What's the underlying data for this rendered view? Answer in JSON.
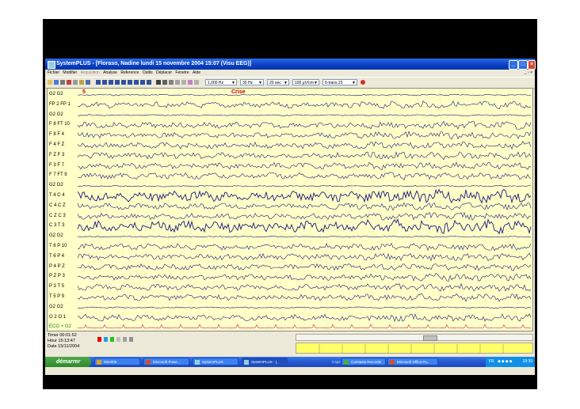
{
  "window": {
    "title": "SystemPLUS - [Floraso, Nadine lundi 15 novembre 2004 15:07 (Visu EEG)]",
    "controls": {
      "minimize": "_",
      "maximize": "□",
      "close": "×"
    }
  },
  "menu": {
    "items": [
      "Fichier",
      "Modifier",
      "Acquisition",
      "Analyse",
      "Reference",
      "Outils",
      "Déplacer",
      "Fenetre",
      "Aide"
    ],
    "right": "_ ▫ ×"
  },
  "toolbar": {
    "frequency": "1,000 Hz",
    "filter": "30 Hz",
    "timebase": "20 sec",
    "gain": "100 µV/cm",
    "montage": "6-trans.23"
  },
  "eeg": {
    "marker_number": "5",
    "marker_label": "Crise",
    "channels": [
      "G2 G2",
      "FP 2 FP 1",
      "G2 G2",
      "F 8 FT 10",
      "F 8 F 4",
      "F 4 F Z",
      "F Z F 3",
      "F 3 F 7",
      "F 7 FT 9",
      "G2 G2",
      "T 4 C 4",
      "C 4 C Z",
      "C Z C 3",
      "C 3 T 3",
      "G2 G2",
      "T 6 P 10",
      "T 6 P 4",
      "P 4 P Z",
      "P Z P 3",
      "P 3 T 5",
      "T 5 P 9",
      "G2 G2",
      "O 2 O 1",
      "ECG + G2"
    ],
    "trace_color": "#1a1a80",
    "ecg_color": "#d0206a",
    "background": "#ffffc8"
  },
  "info": {
    "timer": "Timer  00:01:52",
    "hour": "Hour   15:13:47",
    "date": "Date   15/11/2004"
  },
  "taskbar": {
    "start": "démarrer",
    "tasks": [
      "DB2005",
      "Microsoft Powe...",
      "SystemPLUS",
      "SystemPLUS - [...",
      "Camtasia Recorder",
      "Microsoft Office Po..."
    ],
    "caps": "Caps",
    "lang": "FR",
    "clock": "18:39"
  }
}
